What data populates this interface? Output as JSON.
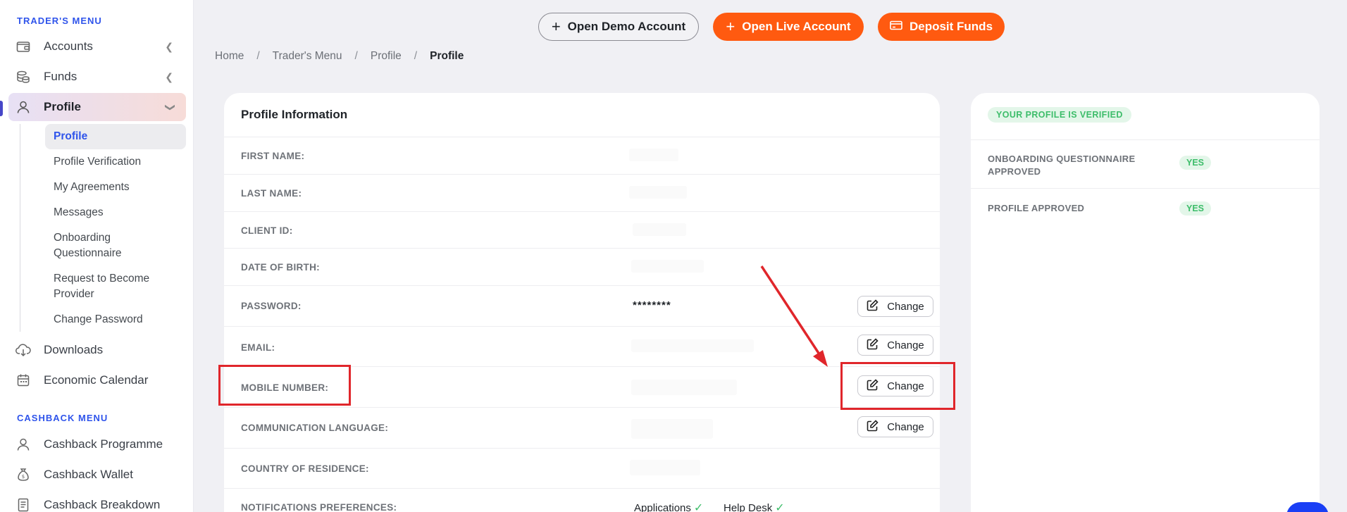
{
  "sidebar": {
    "traders_menu_title": "TRADER'S MENU",
    "cashback_menu_title": "CASHBACK MENU",
    "items": [
      {
        "label": "Accounts",
        "icon": "wallet-icon"
      },
      {
        "label": "Funds",
        "icon": "coins-icon"
      },
      {
        "label": "Profile",
        "icon": "user-icon"
      }
    ],
    "profile_sub": [
      "Profile",
      "Profile Verification",
      "My Agreements",
      "Messages",
      "Onboarding Questionnaire",
      "Request to Become Provider",
      "Change Password"
    ],
    "downloads": "Downloads",
    "economic_calendar": "Economic Calendar",
    "cashback_items": [
      "Cashback Programme",
      "Cashback Wallet",
      "Cashback Breakdown"
    ]
  },
  "topbar": {
    "demo": "Open Demo Account",
    "live": "Open Live Account",
    "deposit": "Deposit Funds"
  },
  "breadcrumb": [
    "Home",
    "Trader's Menu",
    "Profile",
    "Profile"
  ],
  "profile": {
    "title": "Profile Information",
    "change_label": "Change",
    "fields": {
      "first_name": "FIRST NAME:",
      "last_name": "LAST NAME:",
      "client_id": "CLIENT ID:",
      "dob": "DATE OF BIRTH:",
      "password": "PASSWORD:",
      "password_value": "********",
      "email": "EMAIL:",
      "mobile": "MOBILE NUMBER:",
      "language": "COMMUNICATION LANGUAGE:",
      "country": "COUNTRY OF RESIDENCE:",
      "notifications": "NOTIFICATIONS PREFERENCES:",
      "notif_applications": "Applications",
      "notif_helpdesk": "Help Desk"
    }
  },
  "verification": {
    "badge": "YOUR PROFILE IS VERIFIED",
    "onboarding": "ONBOARDING QUESTIONNAIRE APPROVED",
    "onboarding_status": "YES",
    "profile_approved": "PROFILE APPROVED",
    "profile_status": "YES"
  },
  "colors": {
    "accent_orange": "#ff5a10",
    "accent_blue": "#2f54eb",
    "success_green": "#3dbd6a",
    "annotation_red": "#e0262b"
  }
}
